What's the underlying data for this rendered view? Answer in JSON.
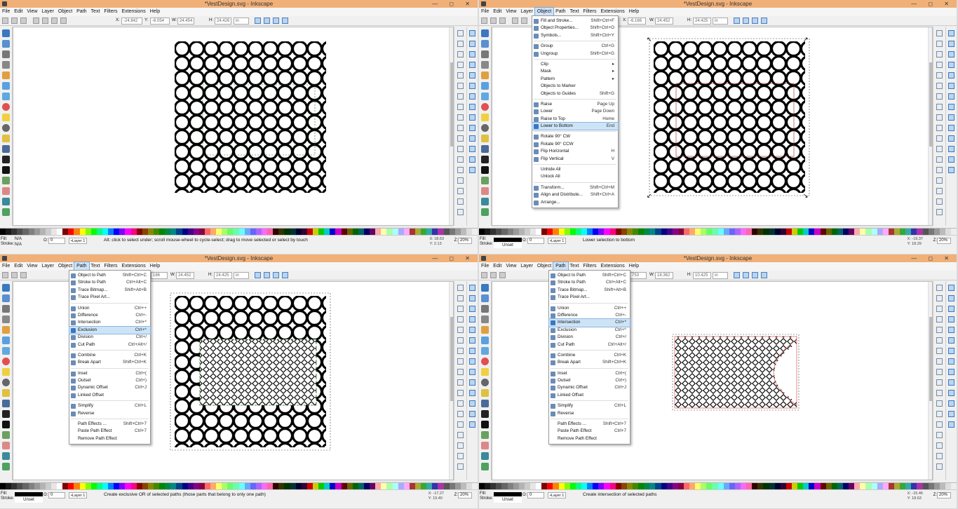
{
  "title": "*VestDesign.svg - Inkscape",
  "window_buttons": "— ◻ ✕",
  "menubar": [
    "File",
    "Edit",
    "View",
    "Layer",
    "Object",
    "Path",
    "Text",
    "Filters",
    "Extensions",
    "Help"
  ],
  "q1": {
    "tool": {
      "x_label": "X:",
      "x": "-24.842",
      "y_label": "Y:",
      "y": "-6.054",
      "w_label": "W:",
      "w": "24.454",
      "h_label": "H:",
      "h": "24.426",
      "unit": "in"
    },
    "status": {
      "fill_label": "Fill:",
      "fill": "N/A",
      "stroke_label": "Stroke:",
      "stroke": "N/A",
      "o_label": "O:",
      "o": "0",
      "layer": "•Layer 1",
      "msg": "Alt: click to select under; scroll mouse-wheel to cycle-select; drag to move selected or select by touch",
      "x": "X:  18.63",
      "y": "Y:   2.13",
      "z_label": "Z:",
      "zoom": "20%"
    }
  },
  "q2": {
    "tool": {
      "x_label": "X:",
      "x": "-6.166",
      "w_label": "W:",
      "w": "24.452",
      "h_label": "H:",
      "h": "24.425",
      "unit": "in"
    },
    "status": {
      "fill_label": "Fill:",
      "stroke_label": "Stroke:",
      "stroke": "Unset",
      "o_label": "O:",
      "o": "0",
      "layer": "•Layer 1",
      "msg": "Lower selection to bottom",
      "x": "X: -19.37",
      "y": "Y:  18.29",
      "z_label": "Z:",
      "zoom": "20%"
    },
    "menu": [
      {
        "label": "Fill and Stroke...",
        "shortcut": "Shift+Ctrl+F",
        "icon": "fill-stroke-icon"
      },
      {
        "label": "Object Properties...",
        "shortcut": "Shift+Ctrl+O",
        "icon": "object-properties-icon"
      },
      {
        "label": "Symbols...",
        "shortcut": "Shift+Ctrl+Y",
        "icon": "symbols-icon"
      },
      {
        "sep": true
      },
      {
        "label": "Group",
        "shortcut": "Ctrl+G",
        "icon": "group-icon"
      },
      {
        "label": "Ungroup",
        "shortcut": "Shift+Ctrl+G",
        "icon": "ungroup-icon"
      },
      {
        "sep": true
      },
      {
        "label": "Clip",
        "shortcut": "▸"
      },
      {
        "label": "Mask",
        "shortcut": "▸"
      },
      {
        "label": "Pattern",
        "shortcut": "▸"
      },
      {
        "label": "Objects to Marker",
        "shortcut": ""
      },
      {
        "label": "Objects to Guides",
        "shortcut": "Shift+G"
      },
      {
        "sep": true
      },
      {
        "label": "Raise",
        "shortcut": "Page Up",
        "icon": "raise-icon"
      },
      {
        "label": "Lower",
        "shortcut": "Page Down",
        "icon": "lower-icon"
      },
      {
        "label": "Raise to Top",
        "shortcut": "Home",
        "icon": "raise-top-icon"
      },
      {
        "label": "Lower to Bottom",
        "shortcut": "End",
        "icon": "lower-bottom-icon",
        "hl": true
      },
      {
        "sep": true
      },
      {
        "label": "Rotate 90° CW",
        "shortcut": "",
        "icon": "rotate-cw-icon"
      },
      {
        "label": "Rotate 90° CCW",
        "shortcut": "",
        "icon": "rotate-ccw-icon"
      },
      {
        "label": "Flip Horizontal",
        "shortcut": "H",
        "icon": "flip-h-icon"
      },
      {
        "label": "Flip Vertical",
        "shortcut": "V",
        "icon": "flip-v-icon"
      },
      {
        "sep": true
      },
      {
        "label": "Unhide All",
        "shortcut": ""
      },
      {
        "label": "Unlock All",
        "shortcut": ""
      },
      {
        "sep": true
      },
      {
        "label": "Transform...",
        "shortcut": "Shift+Ctrl+M",
        "icon": "transform-icon"
      },
      {
        "label": "Align and Distribute...",
        "shortcut": "Shift+Ctrl+A",
        "icon": "align-icon"
      },
      {
        "label": "Arrange...",
        "shortcut": "",
        "icon": "arrange-icon"
      }
    ]
  },
  "q3": {
    "tool": {
      "x": "166",
      "w_label": "W:",
      "w": "24.452",
      "h_label": "H:",
      "h": "24.425",
      "unit": "in"
    },
    "status": {
      "fill_label": "Fill:",
      "stroke_label": "Stroke:",
      "stroke": "Unset",
      "o_label": "O:",
      "o": "0",
      "layer": "•Layer 1",
      "msg": "Create exclusive OR of selected paths (those parts that belong to only one path)",
      "x": "X: -17.27",
      "y": "Y:  19.40",
      "z_label": "Z:",
      "zoom": "20%"
    },
    "menu": [
      {
        "label": "Object to Path",
        "shortcut": "Shift+Ctrl+C",
        "icon": "object-to-path-icon"
      },
      {
        "label": "Stroke to Path",
        "shortcut": "Ctrl+Alt+C",
        "icon": "stroke-to-path-icon"
      },
      {
        "label": "Trace Bitmap...",
        "shortcut": "Shift+Alt+B",
        "icon": "trace-bitmap-icon"
      },
      {
        "label": "Trace Pixel Art...",
        "shortcut": "",
        "icon": "trace-pixel-icon"
      },
      {
        "sep": true
      },
      {
        "label": "Union",
        "shortcut": "Ctrl++",
        "icon": "union-icon"
      },
      {
        "label": "Difference",
        "shortcut": "Ctrl+-",
        "icon": "difference-icon"
      },
      {
        "label": "Intersection",
        "shortcut": "Ctrl+*",
        "icon": "intersection-icon"
      },
      {
        "label": "Exclusion",
        "shortcut": "Ctrl+^",
        "icon": "exclusion-icon",
        "hl": true
      },
      {
        "label": "Division",
        "shortcut": "Ctrl+/",
        "icon": "division-icon"
      },
      {
        "label": "Cut Path",
        "shortcut": "Ctrl+Alt+/",
        "icon": "cut-path-icon"
      },
      {
        "sep": true
      },
      {
        "label": "Combine",
        "shortcut": "Ctrl+K",
        "icon": "combine-icon"
      },
      {
        "label": "Break Apart",
        "shortcut": "Shift+Ctrl+K",
        "icon": "break-apart-icon"
      },
      {
        "sep": true
      },
      {
        "label": "Inset",
        "shortcut": "Ctrl+(",
        "icon": "inset-icon"
      },
      {
        "label": "Outset",
        "shortcut": "Ctrl+)",
        "icon": "outset-icon"
      },
      {
        "label": "Dynamic Offset",
        "shortcut": "Ctrl+J",
        "icon": "dynamic-offset-icon"
      },
      {
        "label": "Linked Offset",
        "shortcut": "",
        "icon": "linked-offset-icon"
      },
      {
        "sep": true
      },
      {
        "label": "Simplify",
        "shortcut": "Ctrl+L",
        "icon": "simplify-icon"
      },
      {
        "label": "Reverse",
        "shortcut": "",
        "icon": "reverse-icon"
      },
      {
        "sep": true
      },
      {
        "label": "Path Effects ...",
        "shortcut": "Shift+Ctrl+7",
        "icon": ""
      },
      {
        "label": "Paste Path Effect",
        "shortcut": "Ctrl+7",
        "icon": ""
      },
      {
        "label": "Remove Path Effect",
        "shortcut": "",
        "icon": ""
      }
    ]
  },
  "q4": {
    "tool": {
      "x": "753",
      "w_label": "W:",
      "w": "18.362",
      "h_label": "H:",
      "h": "10.425",
      "unit": "in"
    },
    "status": {
      "fill_label": "Fill:",
      "stroke_label": "Stroke:",
      "stroke": "Unset",
      "o_label": "O:",
      "o": "0",
      "layer": "•Layer 1",
      "msg": "Create intersection of selected paths",
      "x": "X: -15.46",
      "y": "Y:  18.63",
      "z_label": "Z:",
      "zoom": "20%"
    },
    "menu_highlight": "Intersection"
  },
  "colors": {
    "titlebar": "#f0b078",
    "menu_highlight": "#cde4f7",
    "selection": "#3a78c0"
  }
}
